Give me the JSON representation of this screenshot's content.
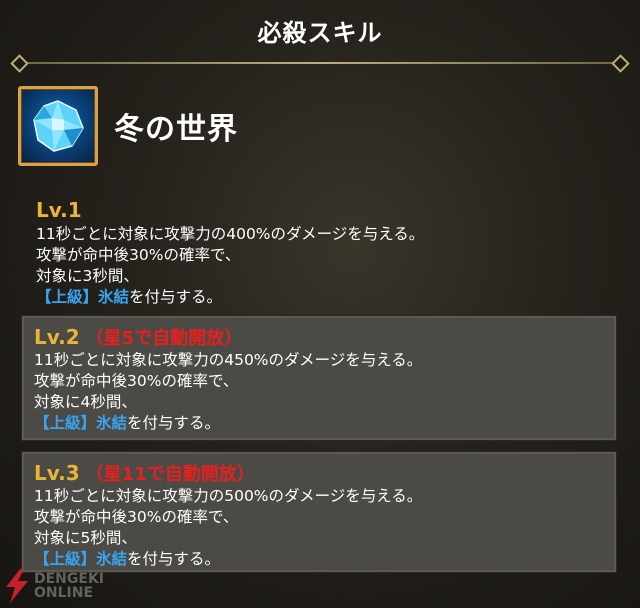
{
  "header": {
    "title": "必殺スキル"
  },
  "skill": {
    "name": "冬の世界",
    "icon": "ice-crystal-icon"
  },
  "levels": [
    {
      "label": "Lv.1",
      "unlock": "",
      "line1": "11秒ごとに対象に攻撃力の400%のダメージを与える。",
      "line2": "攻撃が命中後30%の確率で、",
      "line3": "対象に3秒間、",
      "tag": "【上級】氷結",
      "line4_rest": "を付与する。"
    },
    {
      "label": "Lv.2",
      "unlock": "（星5で自動開放）",
      "line1": "11秒ごとに対象に攻撃力の450%のダメージを与える。",
      "line2": "攻撃が命中後30%の確率で、",
      "line3": "対象に4秒間、",
      "tag": "【上級】氷結",
      "line4_rest": "を付与する。"
    },
    {
      "label": "Lv.3",
      "unlock": "（星11で自動開放）",
      "line1": "11秒ごとに対象に攻撃力の500%のダメージを与える。",
      "line2": "攻撃が命中後30%の確率で、",
      "line3": "対象に5秒間、",
      "tag": "【上級】氷結",
      "line4_rest": "を付与する。"
    }
  ],
  "watermark": {
    "line1": "DENGEKI",
    "line2": "ONLINE"
  },
  "colors": {
    "level_label": "#e9b43a",
    "unlock_text": "#e62020",
    "tag_text": "#3aa3ee",
    "icon_frame": "#d9a24a"
  }
}
